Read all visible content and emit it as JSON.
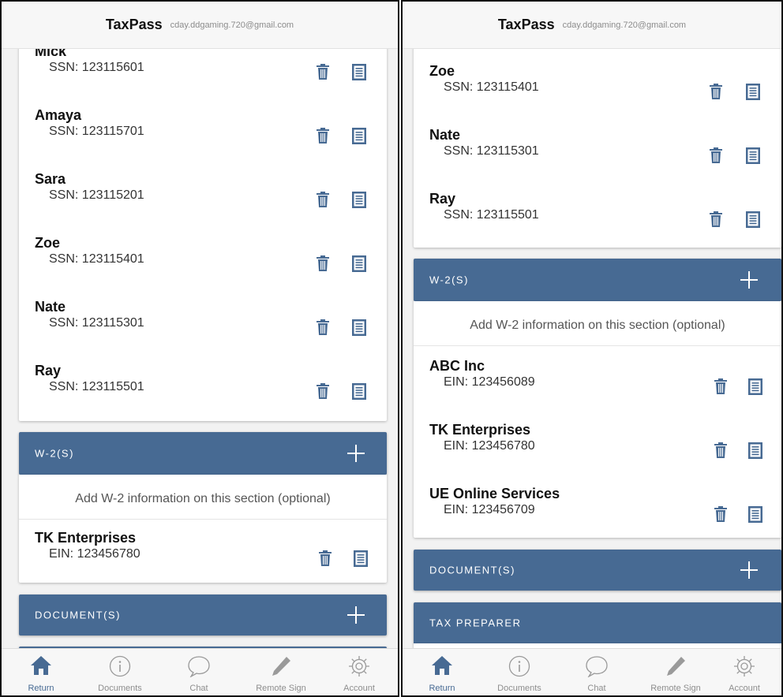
{
  "app": {
    "brand": "TaxPass",
    "email": "cday.ddgaming.720@gmail.com"
  },
  "colors": {
    "accent": "#476a93",
    "icon": "#476a93",
    "background": "#f2f2f2",
    "bar_text": "#ffffff"
  },
  "left": {
    "dependents": [
      {
        "name": "Mick",
        "ssn_label": "SSN: 123115601"
      },
      {
        "name": "Amaya",
        "ssn_label": "SSN: 123115701"
      },
      {
        "name": "Sara",
        "ssn_label": "SSN: 123115201"
      },
      {
        "name": "Zoe",
        "ssn_label": "SSN: 123115401"
      },
      {
        "name": "Nate",
        "ssn_label": "SSN: 123115301"
      },
      {
        "name": "Ray",
        "ssn_label": "SSN: 123115501"
      }
    ],
    "w2_section": {
      "title": "W-2(S)",
      "hint": "Add W-2 information on this section (optional)",
      "items": [
        {
          "name": "TK Enterprises",
          "ein_label": "EIN: 123456780"
        }
      ]
    },
    "documents_section": {
      "title": "DOCUMENT(S)"
    }
  },
  "right": {
    "dependents": [
      {
        "name": "Zoe",
        "ssn_label": "SSN: 123115401"
      },
      {
        "name": "Nate",
        "ssn_label": "SSN: 123115301"
      },
      {
        "name": "Ray",
        "ssn_label": "SSN: 123115501"
      }
    ],
    "w2_section": {
      "title": "W-2(S)",
      "hint": "Add W-2 information on this section (optional)",
      "items": [
        {
          "name": "ABC Inc",
          "ein_label": "EIN: 123456089"
        },
        {
          "name": "TK Enterprises",
          "ein_label": "EIN: 123456780"
        },
        {
          "name": "UE Online Services",
          "ein_label": "EIN: 123456709"
        }
      ]
    },
    "documents_section": {
      "title": "DOCUMENT(S)"
    },
    "tax_preparer_section": {
      "title": "TAX PREPARER"
    }
  },
  "tabs": [
    {
      "label": "Return",
      "icon": "home-icon",
      "active": true
    },
    {
      "label": "Documents",
      "icon": "info-icon",
      "active": false
    },
    {
      "label": "Chat",
      "icon": "chat-bubble-icon",
      "active": false
    },
    {
      "label": "Remote Sign",
      "icon": "pencil-icon",
      "active": false
    },
    {
      "label": "Account",
      "icon": "gear-icon",
      "active": false
    }
  ]
}
